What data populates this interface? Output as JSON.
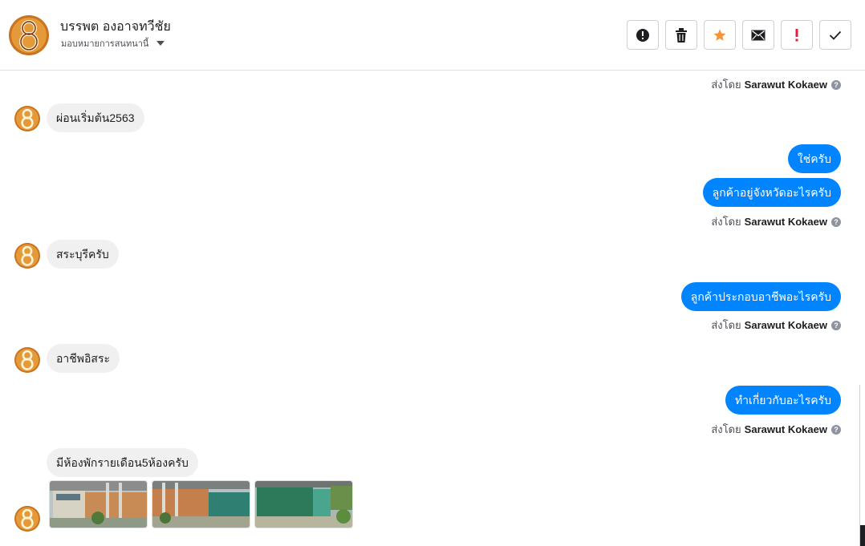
{
  "header": {
    "contact_name": "บรรพต องอาจทวีชัย",
    "assign_label": "มอบหมายการสนทนานี้",
    "toolbar": [
      {
        "name": "mark-spam-button",
        "icon": "alert-circle-icon"
      },
      {
        "name": "delete-button",
        "icon": "trash-icon"
      },
      {
        "name": "star-button",
        "icon": "star-icon"
      },
      {
        "name": "mark-unread-button",
        "icon": "envelope-icon"
      },
      {
        "name": "follow-up-button",
        "icon": "exclamation-icon"
      },
      {
        "name": "mark-done-button",
        "icon": "check-icon"
      }
    ]
  },
  "sent_by": {
    "prefix": "ส่งโดย",
    "agent": "Sarawut Kokaew",
    "help": "?"
  },
  "messages": [
    {
      "dir": "in",
      "text": "ผ่อนเริ่มต้น2563"
    },
    {
      "dir": "out",
      "text": "ใช่ครับ"
    },
    {
      "dir": "out",
      "text": "ลูกค้าอยู่จังหวัดอะไรครับ"
    },
    {
      "dir": "in",
      "text": "สระบุรีครับ"
    },
    {
      "dir": "out",
      "text": "ลูกค้าประกอบอาชีพอะไรครับ"
    },
    {
      "dir": "in",
      "text": "อาชีพอิสระ"
    },
    {
      "dir": "out",
      "text": "ทำเกี่ยวกับอะไรครับ"
    },
    {
      "dir": "in",
      "text": "มีห้องพักรายเดือน5ห้องครับ"
    }
  ],
  "attachments": [
    "house-photo-1",
    "house-photo-2",
    "house-photo-3"
  ],
  "colors": {
    "outgoing_bubble": "#0084ff",
    "incoming_bubble": "#f1f0f0",
    "star": "#f5943a",
    "follow_up": "#e41e3f"
  }
}
